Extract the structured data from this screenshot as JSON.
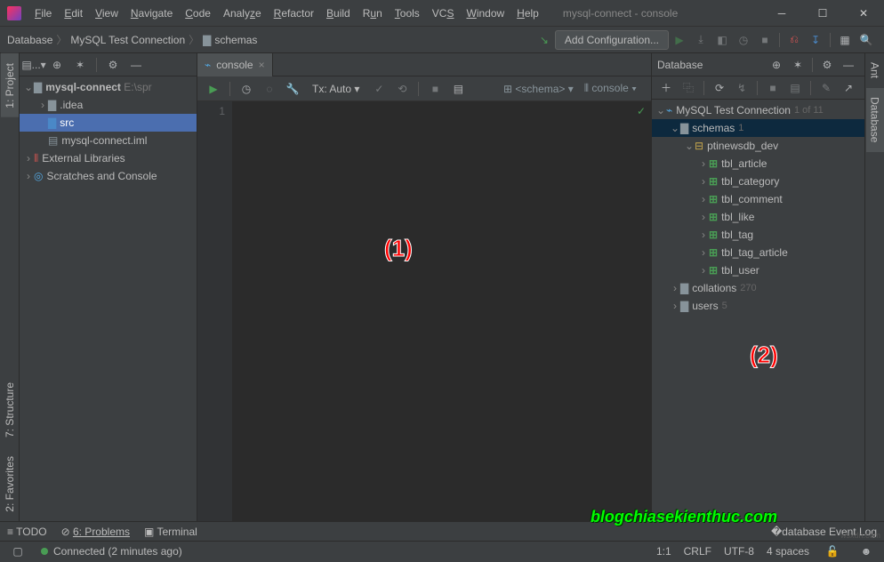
{
  "titlebar": {
    "title": "mysql-connect - console"
  },
  "menu": [
    "File",
    "Edit",
    "View",
    "Navigate",
    "Code",
    "Analyze",
    "Refactor",
    "Build",
    "Run",
    "Tools",
    "VCS",
    "Window",
    "Help"
  ],
  "breadcrumb": {
    "a": "Database",
    "b": "MySQL Test Connection",
    "c": "schemas"
  },
  "toolbar": {
    "config_btn": "Add Configuration..."
  },
  "project": {
    "dropdown": "...",
    "root": "mysql-connect",
    "root_path": "E:\\spr",
    "idea": ".idea",
    "src": "src",
    "iml": "mysql-connect.iml",
    "ext": "External Libraries",
    "scratch": "Scratches and Console"
  },
  "editor": {
    "tab": "console",
    "tx": "Tx: Auto",
    "schema": "<schema>",
    "console": "console",
    "line1": "1"
  },
  "db": {
    "title": "Database",
    "conn": "MySQL Test Connection",
    "conn_hint": "1 of 11",
    "schemas": "schemas",
    "schemas_count": "1",
    "dbname": "ptinewsdb_dev",
    "tables": [
      "tbl_article",
      "tbl_category",
      "tbl_comment",
      "tbl_like",
      "tbl_tag",
      "tbl_tag_article",
      "tbl_user"
    ],
    "collations": "collations",
    "collations_count": "270",
    "users": "users",
    "users_count": "5"
  },
  "left_gutter": {
    "project": "1: Project",
    "structure": "7: Structure",
    "fav": "2: Favorites"
  },
  "right_gutter": {
    "ant": "Ant",
    "database": "Database"
  },
  "bottombar": {
    "todo": "TODO",
    "problems": "6: Problems",
    "terminal": "Terminal",
    "eventlog": "Event Log"
  },
  "statusbar": {
    "connected": "Connected (2 minutes ago)",
    "pos": "1:1",
    "line_sep": "CRLF",
    "enc": "UTF-8",
    "indent": "4 spaces"
  },
  "annot": {
    "one": "(1)",
    "two": "(2)"
  },
  "watermark": "blogchiasekienthuc.com",
  "mini_watermark": "wsxdn.com"
}
